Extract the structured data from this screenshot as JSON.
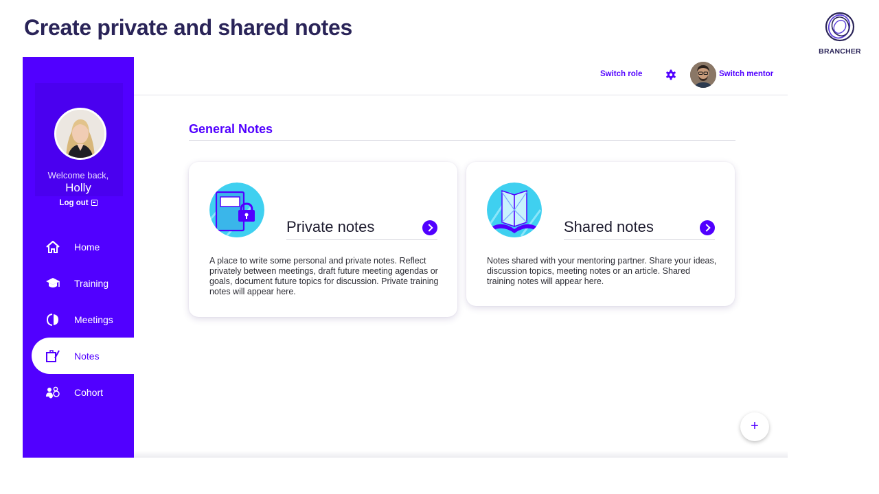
{
  "slide": {
    "title": "Create private and shared notes",
    "brand": "BRANCHER"
  },
  "sidebar": {
    "welcome": "Welcome back,",
    "user_name": "Holly",
    "logout": "Log out",
    "items": [
      {
        "label": "Home",
        "icon": "home-icon"
      },
      {
        "label": "Training",
        "icon": "graduation-cap-icon"
      },
      {
        "label": "Meetings",
        "icon": "meetings-icon"
      },
      {
        "label": "Notes",
        "icon": "notes-icon",
        "active": true
      },
      {
        "label": "Cohort",
        "icon": "cohort-icon"
      }
    ]
  },
  "topbar": {
    "switch_role": "Switch role",
    "switch_mentor": "Switch mentor",
    "settings_icon": "gear-icon"
  },
  "main": {
    "section_title": "General Notes",
    "cards": [
      {
        "title": "Private notes",
        "description": "A place to write some personal and private notes. Reflect privately between meetings, draft future meeting agendas or goals, document future topics for discussion. Private training notes will appear here.",
        "icon": "padlock-notebook-icon"
      },
      {
        "title": "Shared notes",
        "description": "Notes shared with your mentoring partner. Share your ideas, discussion topics, meeting notes or an article. Shared training notes will appear here.",
        "icon": "open-book-icon"
      }
    ],
    "fab_label": "+"
  },
  "colors": {
    "accent": "#5100ff",
    "title_navy": "#2a2458",
    "illustration_cyan": "#3fd0f0"
  }
}
